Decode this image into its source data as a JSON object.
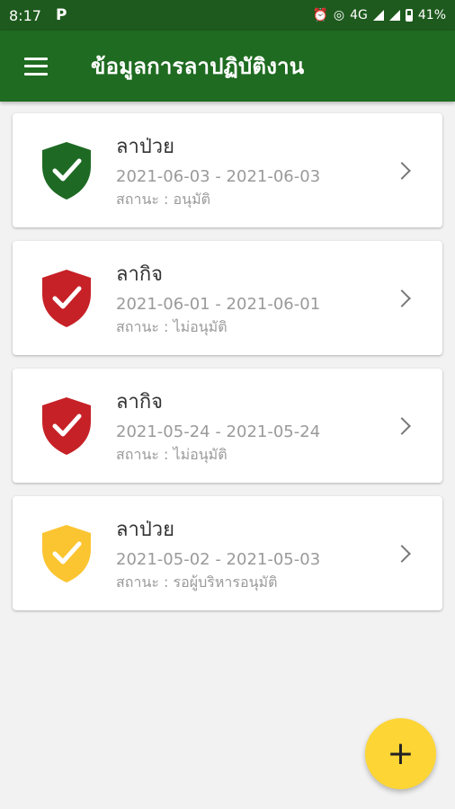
{
  "status_bar": {
    "time": "8:17",
    "app_icon": "P",
    "network": "4G",
    "battery": "41%",
    "icons": [
      "alarm-icon",
      "hotspot-icon",
      "signal-icon",
      "battery-icon"
    ]
  },
  "app_bar": {
    "title": "ข้อมูลการลาปฏิบัติงาน",
    "menu_icon": "hamburger-menu-icon"
  },
  "leaves": [
    {
      "type": "ลาป่วย",
      "dates": "2021-06-03 - 2021-06-03",
      "status": "สถานะ : อนุมัติ",
      "color": "#1e6a24"
    },
    {
      "type": "ลากิจ",
      "dates": "2021-06-01 - 2021-06-01",
      "status": "สถานะ : ไม่อนุมัติ",
      "color": "#c62127"
    },
    {
      "type": "ลากิจ",
      "dates": "2021-05-24 - 2021-05-24",
      "status": "สถานะ : ไม่อนุมัติ",
      "color": "#c62127"
    },
    {
      "type": "ลาป่วย",
      "dates": "2021-05-02 - 2021-05-03",
      "status": "สถานะ : รอผู้บริหารอนุมัติ",
      "color": "#fbc531"
    }
  ],
  "fab": {
    "label": "+",
    "color": "#fdd535"
  }
}
